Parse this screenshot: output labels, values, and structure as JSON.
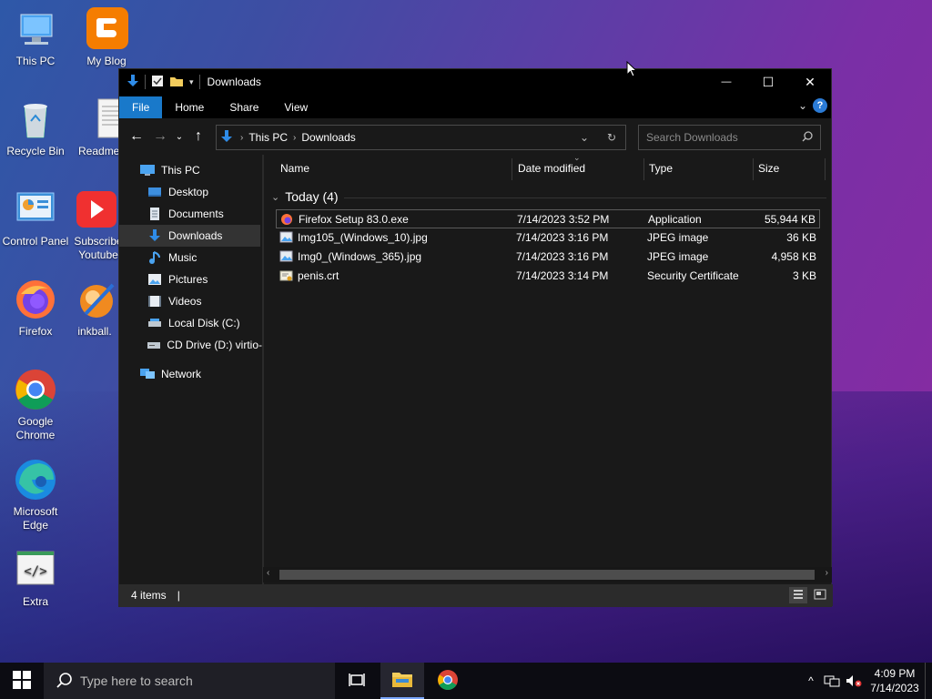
{
  "desktop": {
    "icons": [
      {
        "label": "This PC"
      },
      {
        "label": "My Blog"
      },
      {
        "label": "Recycle Bin"
      },
      {
        "label": "Readme"
      },
      {
        "label": "Control Panel"
      },
      {
        "label": "Subscribe Youtube"
      },
      {
        "label": "Firefox"
      },
      {
        "label": "inkball."
      },
      {
        "label": "Google Chrome"
      },
      {
        "label": "Microsoft Edge"
      },
      {
        "label": "Extra"
      }
    ]
  },
  "window": {
    "title": "Downloads",
    "controls": {
      "minimize": "—",
      "maximize": "☐",
      "close": "✕"
    },
    "ribbon_tabs": [
      "File",
      "Home",
      "Share",
      "View"
    ],
    "address": {
      "crumbs": [
        "This PC",
        "Downloads"
      ]
    },
    "search": {
      "placeholder": "Search Downloads"
    },
    "nav_pane": [
      {
        "label": "This PC",
        "icon": "pc-icon"
      },
      {
        "label": "Desktop",
        "icon": "desktop-folder-icon"
      },
      {
        "label": "Documents",
        "icon": "documents-icon"
      },
      {
        "label": "Downloads",
        "icon": "downloads-icon",
        "selected": true
      },
      {
        "label": "Music",
        "icon": "music-icon"
      },
      {
        "label": "Pictures",
        "icon": "pictures-icon"
      },
      {
        "label": "Videos",
        "icon": "videos-icon"
      },
      {
        "label": "Local Disk (C:)",
        "icon": "drive-icon"
      },
      {
        "label": "CD Drive (D:) virtio-",
        "icon": "cd-drive-icon"
      },
      {
        "label": "Network",
        "icon": "network-icon"
      }
    ],
    "columns": [
      "Name",
      "Date modified",
      "Type",
      "Size"
    ],
    "group": {
      "label": "Today (4)"
    },
    "files": [
      {
        "name": "Firefox Setup 83.0.exe",
        "date": "7/14/2023 3:52 PM",
        "type": "Application",
        "size": "55,944 KB",
        "icon": "firefox-installer-icon"
      },
      {
        "name": "Img105_(Windows_10).jpg",
        "date": "7/14/2023 3:16 PM",
        "type": "JPEG image",
        "size": "36 KB",
        "icon": "image-file-icon"
      },
      {
        "name": "Img0_(Windows_365).jpg",
        "date": "7/14/2023 3:16 PM",
        "type": "JPEG image",
        "size": "4,958 KB",
        "icon": "image-file-icon"
      },
      {
        "name": "penis.crt",
        "date": "7/14/2023 3:14 PM",
        "type": "Security Certificate",
        "size": "3 KB",
        "icon": "certificate-icon"
      }
    ],
    "status": {
      "items": "4 items",
      "separator": "|"
    }
  },
  "taskbar": {
    "search_placeholder": "Type here to search",
    "clock": {
      "time": "4:09 PM",
      "date": "7/14/2023"
    }
  },
  "colors": {
    "accent": "#1979ca",
    "window_bg": "#191919",
    "selected": "#333333"
  }
}
